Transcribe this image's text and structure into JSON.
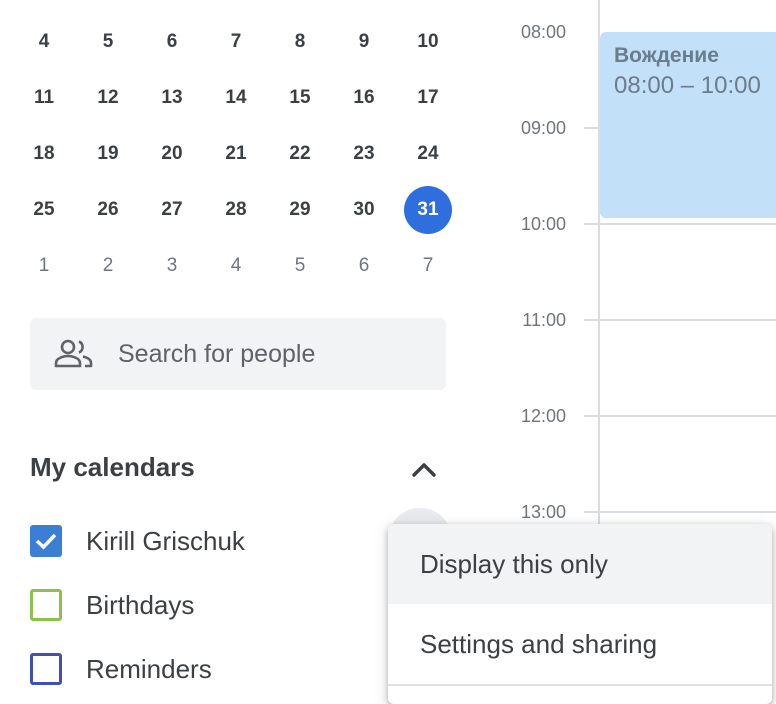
{
  "mini_calendar": {
    "weeks": [
      [
        "4",
        "5",
        "6",
        "7",
        "8",
        "9",
        "10"
      ],
      [
        "11",
        "12",
        "13",
        "14",
        "15",
        "16",
        "17"
      ],
      [
        "18",
        "19",
        "20",
        "21",
        "22",
        "23",
        "24"
      ],
      [
        "25",
        "26",
        "27",
        "28",
        "29",
        "30",
        "31"
      ],
      [
        "1",
        "2",
        "3",
        "4",
        "5",
        "6",
        "7"
      ]
    ],
    "today": "31",
    "today_color": "#2f6fdd"
  },
  "search": {
    "placeholder": "Search for people",
    "icon": "people-icon"
  },
  "my_calendars": {
    "title": "My calendars",
    "collapse_icon": "chevron-up-icon",
    "items": [
      {
        "label": "Kirill Grischuk",
        "checked": true,
        "color": "#3b7fd4"
      },
      {
        "label": "Birthdays",
        "checked": false,
        "color": "#8bc34a"
      },
      {
        "label": "Reminders",
        "checked": false,
        "color": "#3f51b5"
      }
    ]
  },
  "time_grid": {
    "times": [
      "08:00",
      "09:00",
      "10:00",
      "11:00",
      "12:00",
      "13:00"
    ]
  },
  "event": {
    "title": "Вождение",
    "time": "08:00 – 10:00",
    "color": "#c2e0f7"
  },
  "context_menu": {
    "items": [
      {
        "label": "Display this only"
      },
      {
        "label": "Settings and sharing"
      }
    ]
  }
}
